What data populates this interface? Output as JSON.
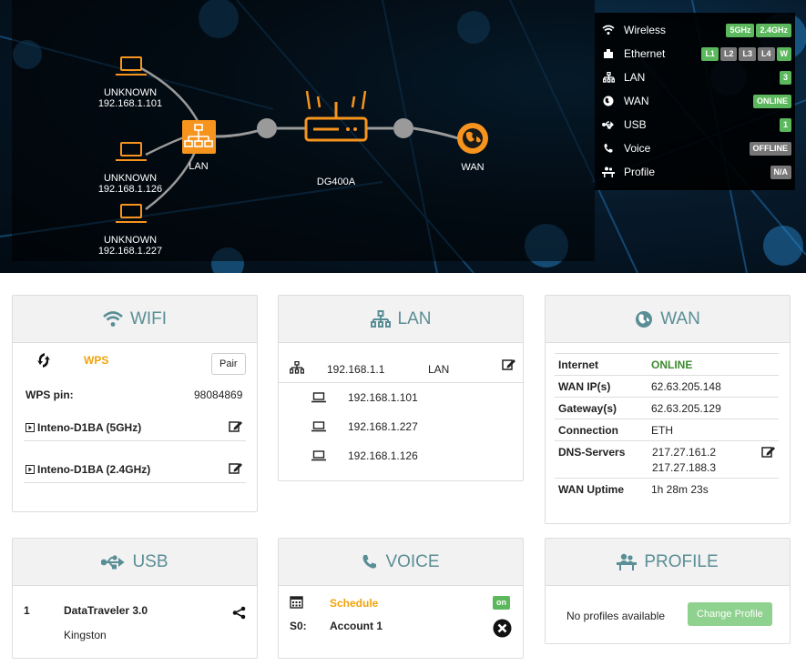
{
  "topology": {
    "clients": [
      {
        "name": "UNKNOWN",
        "ip": "192.168.1.101"
      },
      {
        "name": "UNKNOWN",
        "ip": "192.168.1.126"
      },
      {
        "name": "UNKNOWN",
        "ip": "192.168.1.227"
      }
    ],
    "lan_label": "LAN",
    "router_label": "DG400A",
    "wan_label": "WAN"
  },
  "status": {
    "rows": [
      {
        "label": "Wireless",
        "icon": "wifi-icon",
        "badges": [
          {
            "text": "5GHz",
            "color": "#5cb85c"
          },
          {
            "text": "2.4GHz",
            "color": "#5cb85c"
          }
        ]
      },
      {
        "label": "Ethernet",
        "icon": "ethernet-icon",
        "badges": [
          {
            "text": "L1",
            "color": "#5cb85c"
          },
          {
            "text": "L2",
            "color": "#777777"
          },
          {
            "text": "L3",
            "color": "#777777"
          },
          {
            "text": "L4",
            "color": "#777777"
          },
          {
            "text": "W",
            "color": "#5cb85c"
          }
        ]
      },
      {
        "label": "LAN",
        "icon": "sitemap-icon",
        "badges": [
          {
            "text": "3",
            "color": "#5cb85c"
          }
        ]
      },
      {
        "label": "WAN",
        "icon": "globe-icon",
        "badges": [
          {
            "text": "ONLINE",
            "color": "#5cb85c"
          }
        ]
      },
      {
        "label": "USB",
        "icon": "usb-icon",
        "badges": [
          {
            "text": "1",
            "color": "#5cb85c"
          }
        ]
      },
      {
        "label": "Voice",
        "icon": "phone-icon",
        "badges": [
          {
            "text": "OFFLINE",
            "color": "#777777"
          }
        ]
      },
      {
        "label": "Profile",
        "icon": "profile-icon",
        "badges": [
          {
            "text": "N/A",
            "color": "#777777"
          }
        ]
      }
    ]
  },
  "wifi": {
    "title": "WIFI",
    "wps_label": "WPS",
    "pair_label": "Pair",
    "pin_label": "WPS pin:",
    "pin_value": "98084869",
    "networks": [
      "Inteno-D1BA (5GHz)",
      "Inteno-D1BA (2.4GHz)"
    ]
  },
  "lan": {
    "title": "LAN",
    "gateway_ip": "192.168.1.1",
    "gateway_label": "LAN",
    "clients": [
      "192.168.1.101",
      "192.168.1.227",
      "192.168.1.126"
    ]
  },
  "wan": {
    "title": "WAN",
    "internet_label": "Internet",
    "internet_value": "ONLINE",
    "ip_label": "WAN IP(s)",
    "ip_value": "62.63.205.148",
    "gw_label": "Gateway(s)",
    "gw_value": "62.63.205.129",
    "conn_label": "Connection",
    "conn_value": "ETH",
    "dns_label": "DNS-Servers",
    "dns_values": [
      "217.27.161.2",
      "217.27.188.3"
    ],
    "uptime_label": "WAN Uptime",
    "uptime_value": "1h 28m 23s"
  },
  "usb": {
    "title": "USB",
    "index": "1",
    "device_name": "DataTraveler 3.0",
    "vendor": "Kingston"
  },
  "voice": {
    "title": "VOICE",
    "schedule_label": "Schedule",
    "schedule_state": "on",
    "line_label": "S0:",
    "account": "Account 1"
  },
  "profile": {
    "title": "PROFILE",
    "message": "No profiles available",
    "button_label": "Change Profile"
  },
  "colors": {
    "accent": "#5a8e96",
    "orange": "#f0a30a",
    "green": "#5cb85c",
    "grey": "#777777"
  }
}
